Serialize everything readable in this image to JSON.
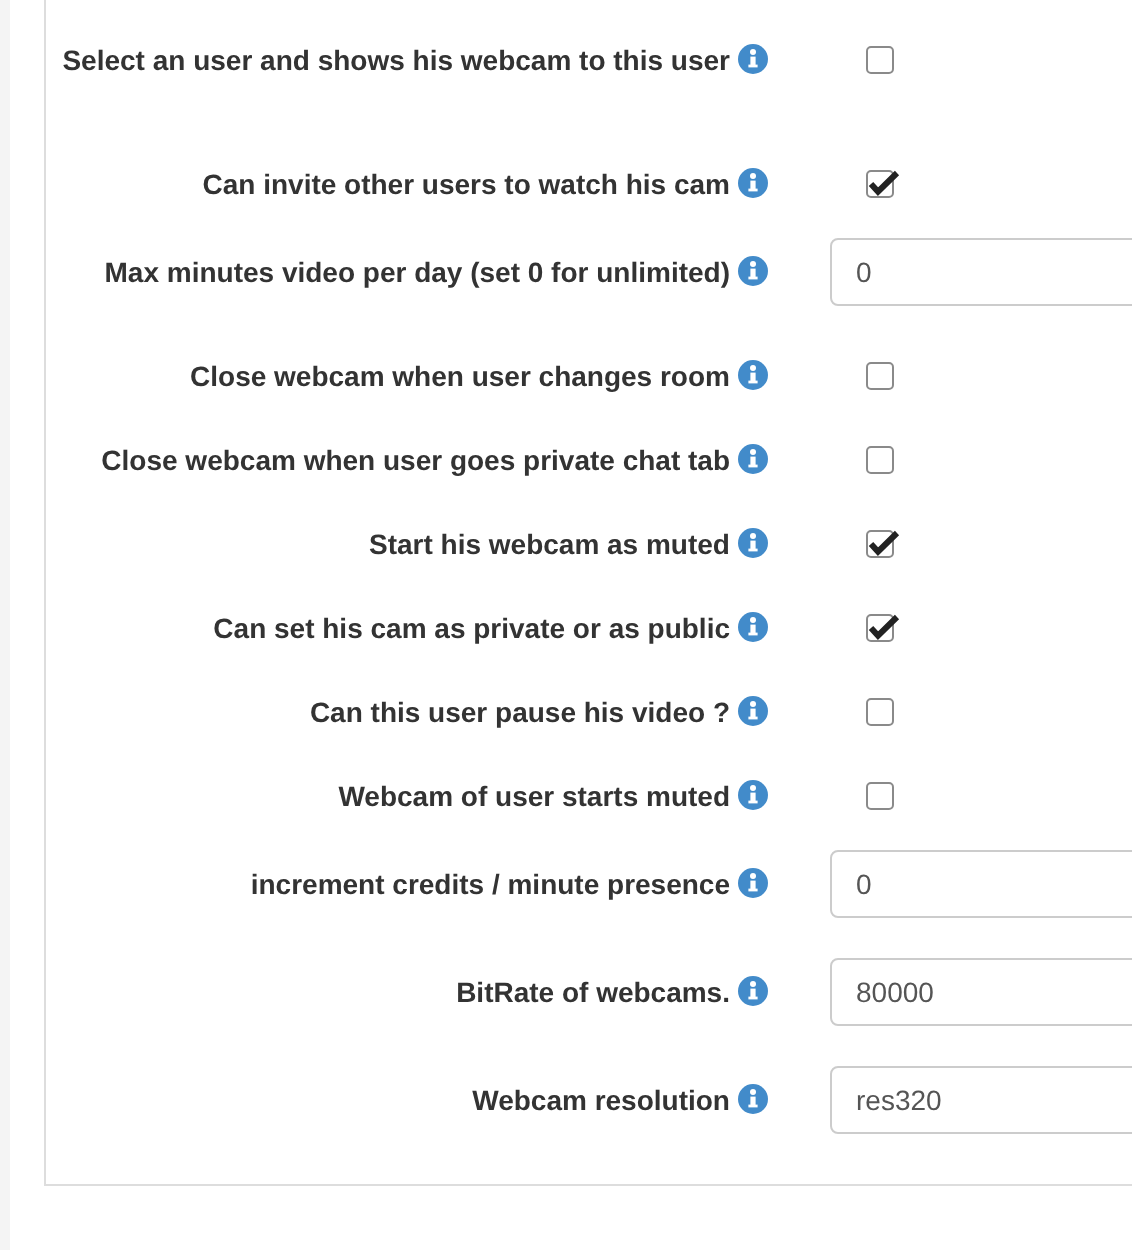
{
  "settings": [
    {
      "kind": "checkbox",
      "label": "Select an user and shows his webcam to this user",
      "checked": false
    },
    {
      "kind": "checkbox",
      "label": "Can invite other users to watch his cam",
      "checked": true
    },
    {
      "kind": "input",
      "label": "Max minutes video per day (set 0 for unlimited)",
      "value": "0"
    },
    {
      "kind": "checkbox",
      "label": "Close webcam when user changes room",
      "checked": false
    },
    {
      "kind": "checkbox",
      "label": "Close webcam when user goes private chat tab",
      "checked": false
    },
    {
      "kind": "checkbox",
      "label": "Start his webcam as muted",
      "checked": true
    },
    {
      "kind": "checkbox",
      "label": "Can set his cam as private or as public",
      "checked": true
    },
    {
      "kind": "checkbox",
      "label": "Can this user pause his video ?",
      "checked": false
    },
    {
      "kind": "checkbox",
      "label": "Webcam of user starts muted",
      "checked": false
    },
    {
      "kind": "input",
      "label": "increment credits / minute presence",
      "value": "0"
    },
    {
      "kind": "input",
      "label": "BitRate of webcams.",
      "value": "80000"
    },
    {
      "kind": "input",
      "label": "Webcam resolution",
      "value": "res320"
    }
  ]
}
